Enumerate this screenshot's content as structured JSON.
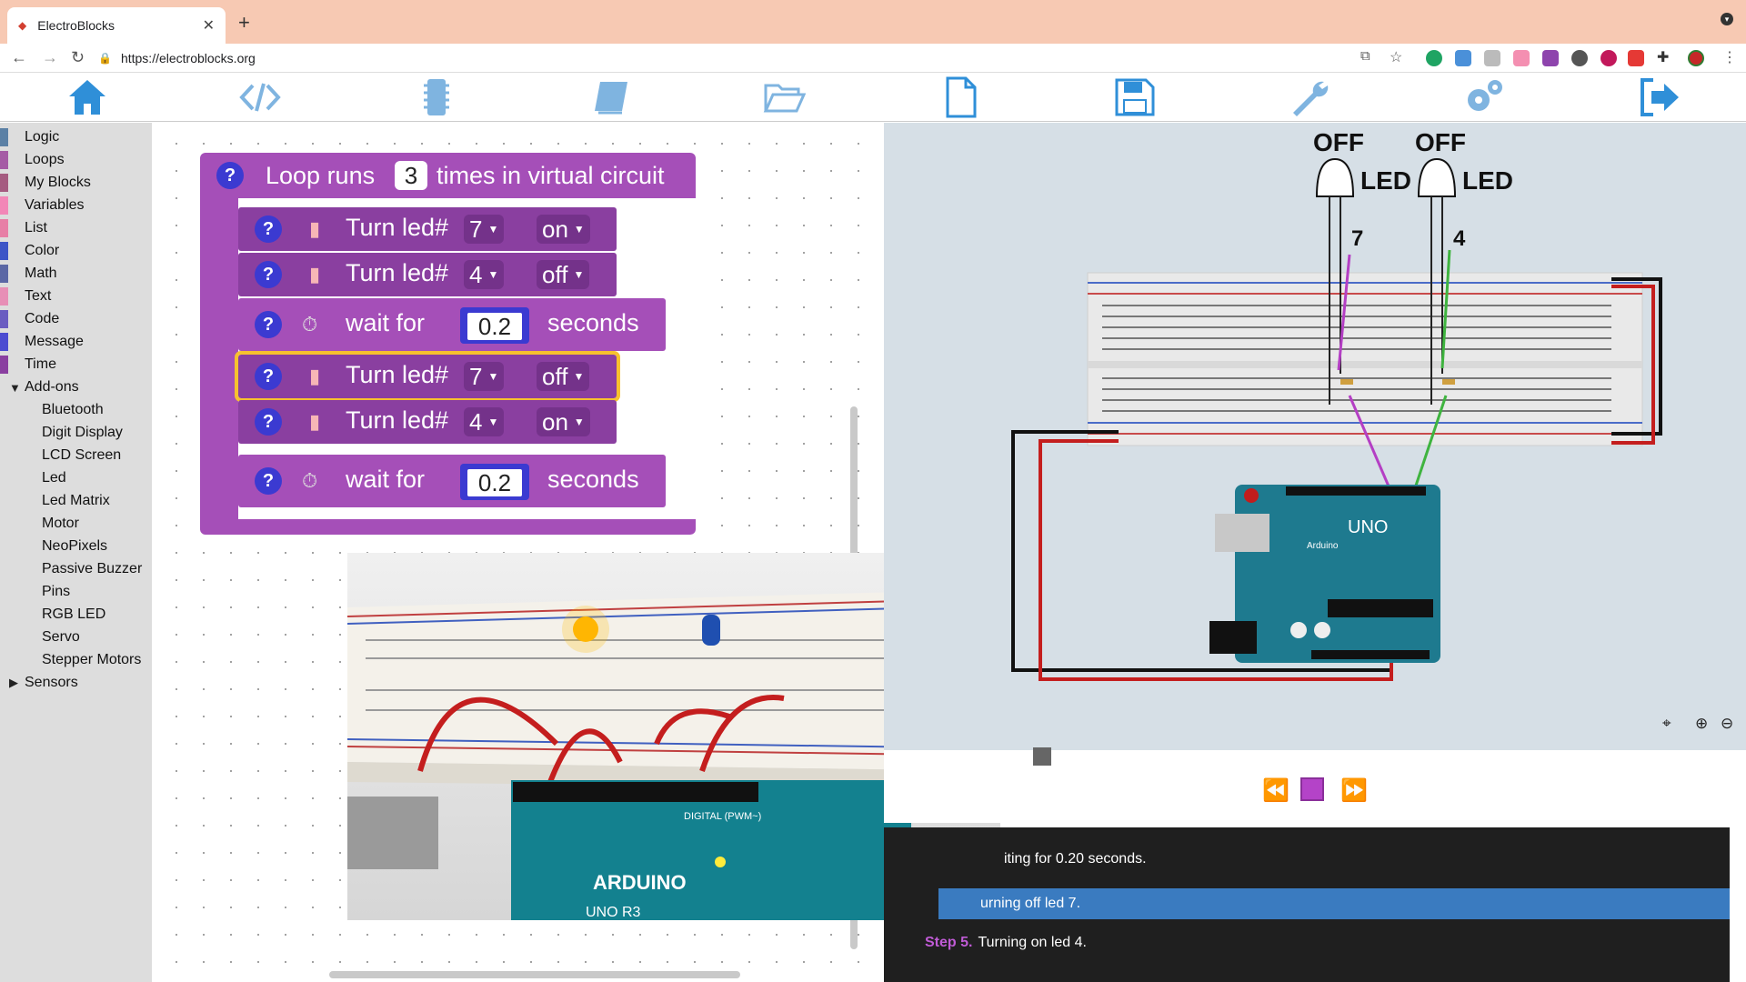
{
  "browser": {
    "tab_title": "ElectroBlocks",
    "url": "https://electroblocks.org"
  },
  "sidebar": {
    "categories": [
      {
        "label": "Logic",
        "color": "#5b80a5"
      },
      {
        "label": "Loops",
        "color": "#a55ba5"
      },
      {
        "label": "My Blocks",
        "color": "#a55b80"
      },
      {
        "label": "Variables",
        "color": "#f287b7"
      },
      {
        "label": "List",
        "color": "#e77fa6"
      },
      {
        "label": "Color",
        "color": "#3d55c7"
      },
      {
        "label": "Math",
        "color": "#5b67a5"
      },
      {
        "label": "Text",
        "color": "#e78fb6"
      },
      {
        "label": "Code",
        "color": "#6a5cc1"
      },
      {
        "label": "Message",
        "color": "#4b4bd1"
      },
      {
        "label": "Time",
        "color": "#8a3fa0"
      },
      {
        "label": "Add-ons",
        "color": "#b24ccb"
      }
    ],
    "addons": [
      "Bluetooth",
      "Digit Display",
      "LCD Screen",
      "Led",
      "Led Matrix",
      "Motor",
      "NeoPixels",
      "Passive Buzzer",
      "Pins",
      "RGB LED",
      "Servo",
      "Stepper Motors"
    ],
    "sensors": {
      "label": "Sensors",
      "color": "#3d55c7"
    }
  },
  "loop_block": {
    "label_a": "Loop runs",
    "count": "3",
    "label_b": "times in virtual circuit"
  },
  "blocks": [
    {
      "type": "led",
      "label": "Turn led#",
      "pin": "7",
      "state": "on"
    },
    {
      "type": "led",
      "label": "Turn led#",
      "pin": "4",
      "state": "off"
    },
    {
      "type": "wait",
      "label": "wait for",
      "value": "0.2",
      "unit": "seconds"
    },
    {
      "type": "led",
      "label": "Turn led#",
      "pin": "7",
      "state": "off",
      "selected": true
    },
    {
      "type": "led",
      "label": "Turn led#",
      "pin": "4",
      "state": "on"
    },
    {
      "type": "wait",
      "label": "wait for",
      "value": "0.2",
      "unit": "seconds"
    }
  ],
  "circuit": {
    "leds": [
      {
        "status": "OFF",
        "label": "LED",
        "pin": "7"
      },
      {
        "status": "OFF",
        "label": "LED",
        "pin": "4"
      }
    ],
    "board_logo": "UNO",
    "board_brand": "Arduino"
  },
  "steps": [
    {
      "number": "",
      "text": "iting for 0.20 seconds."
    },
    {
      "number": "",
      "text": "urning off led 7.",
      "active": true
    },
    {
      "number": "Step 5.",
      "text": "Turning on led 4."
    }
  ],
  "photo": {
    "label": "ARDUINO",
    "model": "UNO R3",
    "digital": "DIGITAL (PWM~)"
  }
}
